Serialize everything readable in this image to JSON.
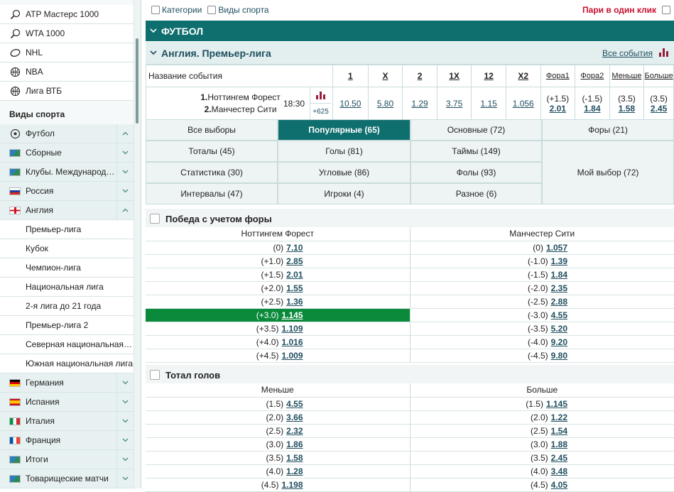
{
  "sidebar": {
    "top_items": [
      {
        "label": "ATP Мастерс 1000",
        "icon": "tennis-racket-icon"
      },
      {
        "label": "WTA 1000",
        "icon": "tennis-racket-icon"
      },
      {
        "label": "NHL",
        "icon": "hockey-puck-icon"
      },
      {
        "label": "NBA",
        "icon": "basketball-icon"
      },
      {
        "label": "Лига ВТБ",
        "icon": "basketball-icon"
      }
    ],
    "section_title": "Виды спорта",
    "sports": [
      {
        "label": "Футбол",
        "icon": "soccer-ball-icon",
        "expanded": true
      },
      {
        "label": "Сборные",
        "icon": "world-flag-icon"
      },
      {
        "label": "Клубы. Международные",
        "icon": "world-flag-icon"
      },
      {
        "label": "Россия",
        "icon": "russia-flag-icon"
      },
      {
        "label": "Англия",
        "icon": "england-flag-icon",
        "expanded": true
      }
    ],
    "england_leagues": [
      "Премьер-лига",
      "Кубок",
      "Чемпион-лига",
      "Национальная лига",
      "2-я лига до 21 года",
      "Премьер-лига 2",
      "Северная национальная лига",
      "Южная национальная лига"
    ],
    "countries": [
      {
        "label": "Германия",
        "icon": "germany-flag-icon"
      },
      {
        "label": "Испания",
        "icon": "spain-flag-icon"
      },
      {
        "label": "Италия",
        "icon": "italy-flag-icon"
      },
      {
        "label": "Франция",
        "icon": "france-flag-icon"
      },
      {
        "label": "Итоги",
        "icon": "world-flag-icon"
      },
      {
        "label": "Товарищеские матчи",
        "icon": "world-flag-icon"
      }
    ]
  },
  "topbar": {
    "categories": "Категории",
    "sports": "Виды спорта",
    "one_click": "Пари в один клик"
  },
  "sport_title": "ФУТБОЛ",
  "league_title": "Англия. Премьер-лига",
  "all_events": "Все события",
  "event_table": {
    "name_header": "Название события",
    "headers": [
      "1",
      "X",
      "2",
      "1X",
      "12",
      "X2",
      "Фора1",
      "Фора2",
      "Меньше",
      "Больше"
    ],
    "team1": "Ноттингем Форест",
    "team2": "Манчестер Сити",
    "n1": "1.",
    "n2": "2.",
    "time": "18:30",
    "more": "+625",
    "odds": [
      "10.50",
      "5.80",
      "1.29",
      "3.75",
      "1.15",
      "1.056"
    ],
    "handicap1": {
      "line": "(+1.5)",
      "odd": "2.01"
    },
    "handicap2": {
      "line": "(-1.5)",
      "odd": "1.84"
    },
    "under": {
      "line": "(3.5)",
      "odd": "1.58"
    },
    "over": {
      "line": "(3.5)",
      "odd": "2.45"
    }
  },
  "filters": [
    "Все выборы",
    "Популярные (65)",
    "Основные (72)",
    "Форы (21)",
    "Тоталы (45)",
    "Голы (81)",
    "Таймы (149)",
    "Статистика (30)",
    "Угловые (86)",
    "Фолы (93)",
    "Мой выбор (72)",
    "Интервалы (47)",
    "Игроки (4)",
    "Разное (6)"
  ],
  "handicap_market": {
    "title": "Победа с учетом форы",
    "col1": "Ноттингем Форест",
    "col2": "Манчестер Сити",
    "rows": [
      {
        "l1": "(0)",
        "o1": "7.10",
        "l2": "(0)",
        "o2": "1.057"
      },
      {
        "l1": "(+1.0)",
        "o1": "2.85",
        "l2": "(-1.0)",
        "o2": "1.39"
      },
      {
        "l1": "(+1.5)",
        "o1": "2.01",
        "l2": "(-1.5)",
        "o2": "1.84"
      },
      {
        "l1": "(+2.0)",
        "o1": "1.55",
        "l2": "(-2.0)",
        "o2": "2.35"
      },
      {
        "l1": "(+2.5)",
        "o1": "1.36",
        "l2": "(-2.5)",
        "o2": "2.88"
      },
      {
        "l1": "(+3.0)",
        "o1": "1.145",
        "l2": "(-3.0)",
        "o2": "4.55",
        "highlight": true
      },
      {
        "l1": "(+3.5)",
        "o1": "1.109",
        "l2": "(-3.5)",
        "o2": "5.20"
      },
      {
        "l1": "(+4.0)",
        "o1": "1.016",
        "l2": "(-4.0)",
        "o2": "9.20"
      },
      {
        "l1": "(+4.5)",
        "o1": "1.009",
        "l2": "(-4.5)",
        "o2": "9.80"
      }
    ]
  },
  "total_market": {
    "title": "Тотал голов",
    "col1": "Меньше",
    "col2": "Больше",
    "rows": [
      {
        "l1": "(1.5)",
        "o1": "4.55",
        "l2": "(1.5)",
        "o2": "1.145"
      },
      {
        "l1": "(2.0)",
        "o1": "3.66",
        "l2": "(2.0)",
        "o2": "1.22"
      },
      {
        "l1": "(2.5)",
        "o1": "2.32",
        "l2": "(2.5)",
        "o2": "1.54"
      },
      {
        "l1": "(3.0)",
        "o1": "1.86",
        "l2": "(3.0)",
        "o2": "1.88"
      },
      {
        "l1": "(3.5)",
        "o1": "1.58",
        "l2": "(3.5)",
        "o2": "2.45"
      },
      {
        "l1": "(4.0)",
        "o1": "1.28",
        "l2": "(4.0)",
        "o2": "3.48"
      },
      {
        "l1": "(4.5)",
        "o1": "1.198",
        "l2": "(4.5)",
        "o2": "4.05"
      }
    ]
  },
  "colors": {
    "accent": "#0f6e6e",
    "highlight": "#0a8a3a",
    "alert": "#c8102e"
  }
}
